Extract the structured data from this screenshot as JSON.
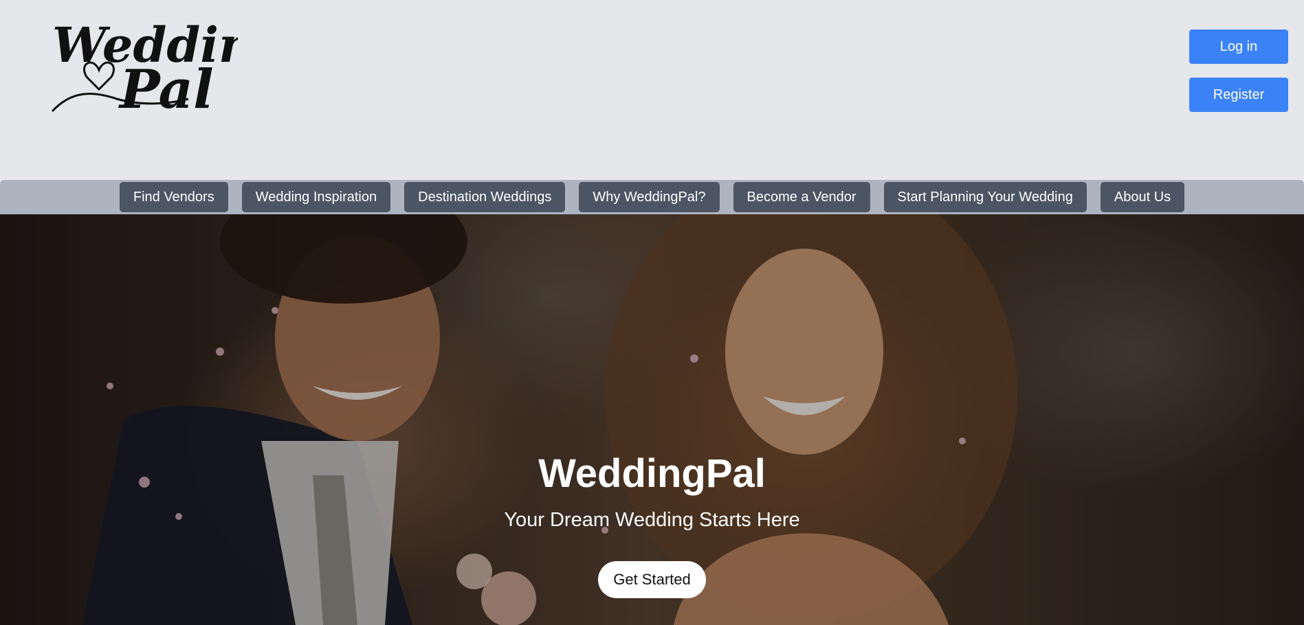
{
  "brand": {
    "logo_line1": "Wedding",
    "logo_line2": "Pal",
    "logo_icon": "heart-icon"
  },
  "auth": {
    "login_label": "Log in",
    "register_label": "Register"
  },
  "nav": {
    "items": [
      {
        "label": "Find Vendors"
      },
      {
        "label": "Wedding Inspiration"
      },
      {
        "label": "Destination Weddings"
      },
      {
        "label": "Why WeddingPal?"
      },
      {
        "label": "Become a Vendor"
      },
      {
        "label": "Start Planning Your Wedding"
      },
      {
        "label": "About Us"
      }
    ]
  },
  "hero": {
    "title": "WeddingPal",
    "subtitle": "Your Dream Wedding Starts Here",
    "cta_label": "Get Started",
    "image": "couple-laughing-photo"
  },
  "colors": {
    "page_bg": "#e5e7eb",
    "primary": "#3b82f6",
    "nav_bar": "#aeb4bf",
    "nav_button": "#4b5563"
  }
}
